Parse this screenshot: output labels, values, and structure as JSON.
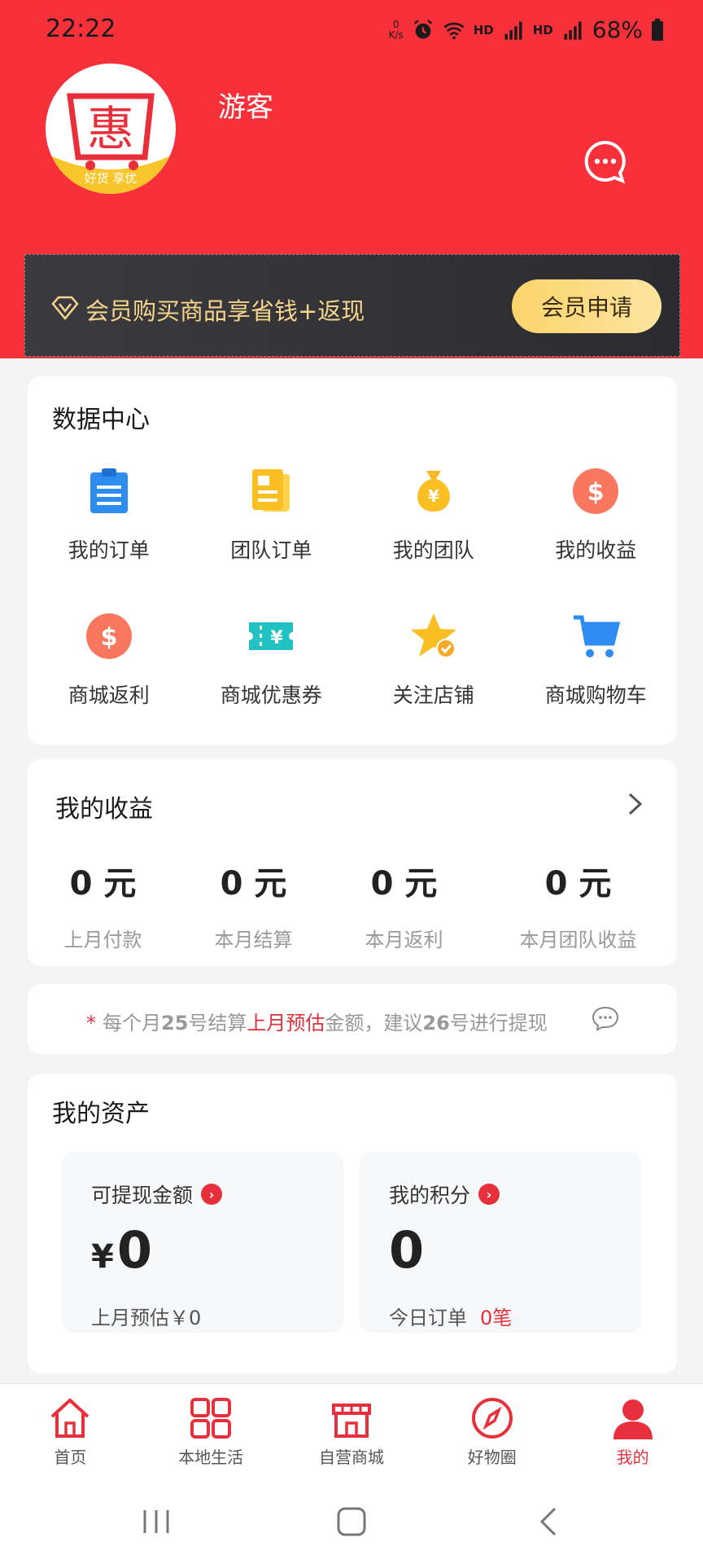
{
  "status_bar": {
    "time": "22:22",
    "net_speed_top": "0",
    "net_speed_bottom": "K/s",
    "hd1": "HD",
    "hd2": "HD",
    "battery": "68%"
  },
  "header": {
    "username": "游客",
    "logo_char": "惠",
    "logo_slogan": "好货 享优"
  },
  "vip": {
    "text": "会员购买商品享省钱+返现",
    "button": "会员申请"
  },
  "data_center": {
    "title": "数据中心",
    "items": [
      {
        "label": "我的订单",
        "icon": "clipboard-icon"
      },
      {
        "label": "团队订单",
        "icon": "document-icon"
      },
      {
        "label": "我的团队",
        "icon": "money-bag-icon"
      },
      {
        "label": "我的收益",
        "icon": "dollar-coin-icon"
      },
      {
        "label": "商城返利",
        "icon": "dollar-coin-icon"
      },
      {
        "label": "商城优惠券",
        "icon": "coupon-icon"
      },
      {
        "label": "关注店铺",
        "icon": "star-check-icon"
      },
      {
        "label": "商城购物车",
        "icon": "cart-icon"
      }
    ]
  },
  "earnings": {
    "title": "我的收益",
    "items": [
      {
        "value": "0 元",
        "label": "上月付款"
      },
      {
        "value": "0 元",
        "label": "本月结算"
      },
      {
        "value": "0 元",
        "label": "本月返利"
      },
      {
        "value": "0 元",
        "label": "本月团队收益"
      }
    ]
  },
  "notice": {
    "star": "*",
    "p1": "每个月",
    "p2": "25",
    "p3": "号结算",
    "p4": "上月预估",
    "p5": "金额，建议",
    "p6": "26",
    "p7": "号进行提现"
  },
  "assets": {
    "title": "我的资产",
    "withdraw": {
      "title": "可提现金额",
      "currency": "¥",
      "value": "0",
      "sub": "上月预估￥0"
    },
    "points": {
      "title": "我的积分",
      "value": "0",
      "sub_label": "今日订单",
      "sub_value": "0笔"
    }
  },
  "tabbar": [
    {
      "label": "首页",
      "icon": "home-icon"
    },
    {
      "label": "本地生活",
      "icon": "grid-icon"
    },
    {
      "label": "自营商城",
      "icon": "store-icon"
    },
    {
      "label": "好物圈",
      "icon": "compass-icon"
    },
    {
      "label": "我的",
      "icon": "user-icon",
      "active": true
    }
  ],
  "colors": {
    "primary_red": "#f7303a",
    "accent_red": "#e8303c",
    "gold": "#f5d48c"
  }
}
